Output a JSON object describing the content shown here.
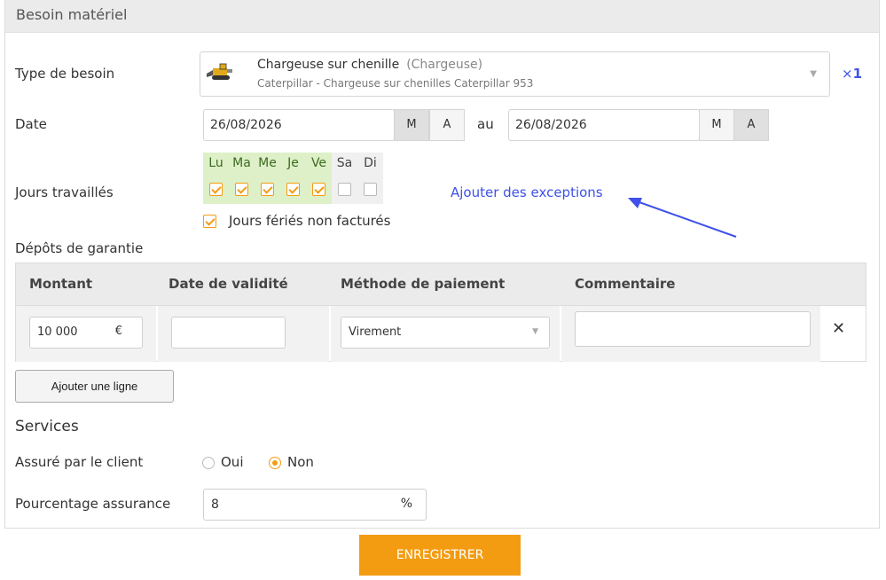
{
  "panel": {
    "title": "Besoin matériel"
  },
  "need_type": {
    "label": "Type de besoin",
    "icon": "wheel-loader-icon",
    "selected_title": "Chargeuse sur chenille",
    "selected_category": "(Chargeuse)",
    "selected_subtitle": "Caterpillar - Chargeuse sur chenilles Caterpillar 953",
    "quantity_prefix": "×",
    "quantity": "1"
  },
  "date": {
    "label": "Date",
    "start": "26/08/2026",
    "separator": "au",
    "end": "26/08/2026",
    "m_label": "M",
    "a_label": "A"
  },
  "work_days": {
    "label": "Jours travaillés",
    "days": [
      {
        "label": "Lu",
        "checked": true
      },
      {
        "label": "Ma",
        "checked": true
      },
      {
        "label": "Me",
        "checked": true
      },
      {
        "label": "Je",
        "checked": true
      },
      {
        "label": "Ve",
        "checked": true
      },
      {
        "label": "Sa",
        "checked": false
      },
      {
        "label": "Di",
        "checked": false
      }
    ],
    "exceptions_link": "Ajouter des exceptions",
    "holidays_label": "Jours fériés non facturés",
    "holidays_checked": true
  },
  "deposits": {
    "title": "Dépôts de garantie",
    "columns": [
      "Montant",
      "Date de validité",
      "Méthode de paiement",
      "Commentaire"
    ],
    "rows": [
      {
        "amount": "10 000",
        "currency": "€",
        "validity": "",
        "method": "Virement",
        "comment": ""
      }
    ],
    "add_row_label": "Ajouter une ligne"
  },
  "services": {
    "title": "Services",
    "insured_label": "Assuré par le client",
    "option_yes": "Oui",
    "option_no": "Non",
    "selected": "Non",
    "percent_label": "Pourcentage assurance",
    "percent_value": "8",
    "percent_unit": "%"
  },
  "save_label": "ENREGISTRER",
  "colors": {
    "accent": "#f39c12",
    "link": "#3f51e8",
    "day_on": "#def0c8"
  }
}
